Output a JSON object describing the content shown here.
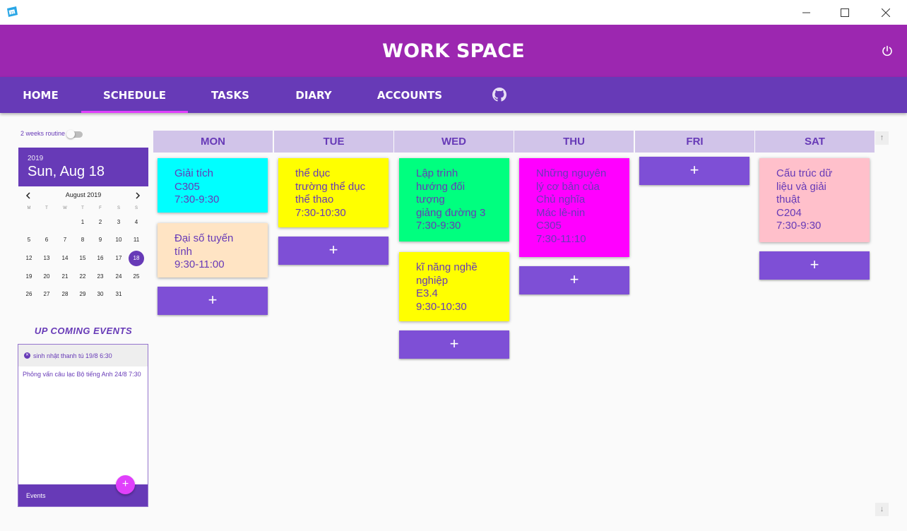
{
  "window": {
    "icon": "app-calendar-icon",
    "buttons": [
      "minimize-icon",
      "maximize-icon",
      "close-icon"
    ]
  },
  "header": {
    "title": "WORK SPACE",
    "power_icon": "power-icon"
  },
  "nav": {
    "tabs": [
      {
        "label": "HOME",
        "active": false
      },
      {
        "label": "SCHEDULE",
        "active": true
      },
      {
        "label": "TASKS",
        "active": false
      },
      {
        "label": "DIARY",
        "active": false
      },
      {
        "label": "ACCOUNTS",
        "active": false
      }
    ],
    "github_icon": "github-icon"
  },
  "routine": {
    "label": "2 weeks routine",
    "enabled": false
  },
  "calendar": {
    "year": "2019",
    "selected_date": "Sun, Aug 18",
    "month_label": "August 2019",
    "weekdays": [
      "M",
      "T",
      "W",
      "T",
      "F",
      "S",
      "S"
    ],
    "weeks": [
      [
        "",
        "",
        "",
        "1",
        "2",
        "3",
        "4"
      ],
      [
        "5",
        "6",
        "7",
        "8",
        "9",
        "10",
        "11"
      ],
      [
        "12",
        "13",
        "14",
        "15",
        "16",
        "17",
        "18"
      ],
      [
        "19",
        "20",
        "21",
        "22",
        "23",
        "24",
        "25"
      ],
      [
        "26",
        "27",
        "28",
        "29",
        "30",
        "31",
        ""
      ]
    ],
    "selected_day": "18"
  },
  "upcoming": {
    "title": "UP COMING EVENTS",
    "items": [
      "sinh nhật thanh tú 19/8 6:30",
      "Phỏng vấn câu lạc Bộ tiếng Anh 24/8 7:30"
    ],
    "footer_label": "Events",
    "add_label": "+"
  },
  "schedule": {
    "days": [
      "MON",
      "TUE",
      "WED",
      "THU",
      "FRI",
      "SAT"
    ],
    "add_label": "+",
    "cards": {
      "mon": [
        {
          "text": "Giải tích\nC305\n7:30-9:30",
          "color": "#00ffff"
        },
        {
          "text": "Đại số tuyến\ntính\n9:30-11:00",
          "color": "#ffe4c4"
        }
      ],
      "tue": [
        {
          "text": "thể dục\ntrường thể dục\nthể thao\n7:30-10:30",
          "color": "#ffff00"
        }
      ],
      "wed": [
        {
          "text": "Lập trình\nhướng đối\ntượng\ngiảng đường 3\n7:30-9:30",
          "color": "#00ff7f"
        },
        {
          "text": "kĩ năng nghề\nnghiệp\nE3.4\n9:30-10:30",
          "color": "#ffff00"
        }
      ],
      "thu": [
        {
          "text": "Những nguyên\nlý cơ bản của\nChủ nghĩa\nMác lê-nin\nC305\n7:30-11:10",
          "color": "#ff00ff"
        }
      ],
      "fri": [],
      "sat": [
        {
          "text": "Cấu trúc dữ\nliệu và giải\nthuật\nC204\n7:30-9:30",
          "color": "#ffc0cb"
        }
      ]
    }
  },
  "colors": {
    "primary": "#673ab7",
    "header": "#9c27b0",
    "accent": "#e040fb",
    "dayhead": "#d1c4e9"
  }
}
